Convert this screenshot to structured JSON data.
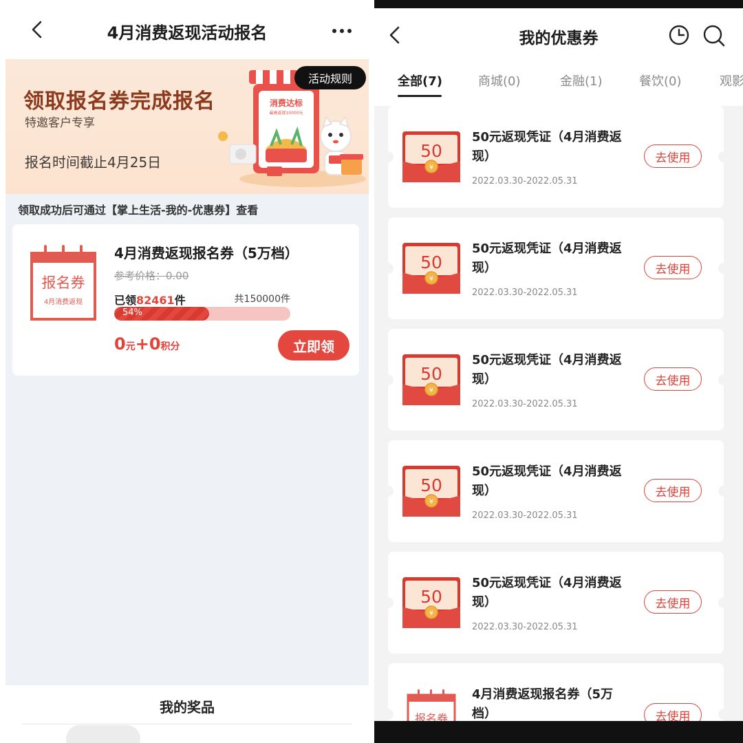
{
  "left": {
    "header": {
      "title": "4月消费返现活动报名"
    },
    "banner": {
      "headline": "领取报名券完成报名",
      "subtitle": "特邀客户专享",
      "deadline": "报名时间截止4月25日",
      "rules_label": "活动规则",
      "art_sign": "消费达标",
      "art_sub": "最高返现10000元"
    },
    "note": "领取成功后可通过【掌上生活-我的-优惠券】查看",
    "coupon": {
      "icon_title": "报名券",
      "icon_sub": "4月消费返现",
      "name": "4月消费返现报名券（5万档）",
      "ref_price": "参考价格：0.00",
      "claimed_prefix": "已领",
      "claimed_count": "82461",
      "claimed_suffix": "件",
      "total": "共150000件",
      "progress_label": "54%",
      "progress": 0.54,
      "price_yuan": "0",
      "price_yuan_unit": "元",
      "price_plus": "+",
      "price_points": "0",
      "price_points_unit": "积分",
      "claim_label": "立即领"
    },
    "prizes_title": "我的奖品"
  },
  "right": {
    "header": {
      "title": "我的优惠券"
    },
    "tabs": [
      "全部(7)",
      "商城(0)",
      "金融(1)",
      "餐饮(0)",
      "观影"
    ],
    "coupons": [
      {
        "value": "50",
        "title": "50元返现凭证（4月消费返现）",
        "dates": "2022.03.30-2022.05.31",
        "action": "去使用"
      },
      {
        "value": "50",
        "title": "50元返现凭证（4月消费返现）",
        "dates": "2022.03.30-2022.05.31",
        "action": "去使用"
      },
      {
        "value": "50",
        "title": "50元返现凭证（4月消费返现）",
        "dates": "2022.03.30-2022.05.31",
        "action": "去使用"
      },
      {
        "value": "50",
        "title": "50元返现凭证（4月消费返现）",
        "dates": "2022.03.30-2022.05.31",
        "action": "去使用"
      },
      {
        "value": "50",
        "title": "50元返现凭证（4月消费返现）",
        "dates": "2022.03.30-2022.05.31",
        "action": "去使用"
      }
    ],
    "last_coupon": {
      "icon_title": "报名券",
      "title": "4月消费返现报名券（5万档）",
      "action": "去使用"
    }
  },
  "colors": {
    "accent": "#e3473d",
    "banner_title": "#8b3a1e",
    "page_bg": "#eef1f6"
  }
}
